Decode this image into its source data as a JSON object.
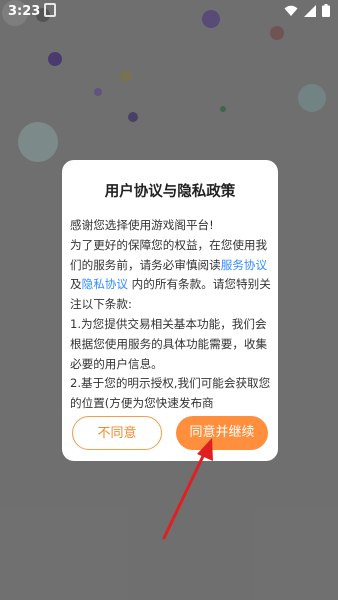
{
  "status_bar": {
    "time": "3:23"
  },
  "dialog": {
    "title": "用户协议与隐私政策",
    "line1": "感谢您选择使用游戏阁平台!",
    "line2a": "  为了更好的保障您的权益，在您使用我们的服务前，请务必审慎阅读",
    "link_service": "服务协议",
    "and": "及",
    "link_privacy": "隐私协议",
    "line2b": " 内的所有条款。请您特别关注以下条款:",
    "item1": " 1.为您提供交易相关基本功能，我们会根据您使用服务的具体功能需要，收集必要的用户信息。",
    "item2": " 2.基于您的明示授权,我们可能会获取您的位置(方便为您快速发布商",
    "btn_disagree": "不同意",
    "btn_agree": "同意并继续"
  },
  "colors": {
    "accent": "#ff8f3d",
    "link": "#2f8cff",
    "annotation_arrow": "#e02020"
  }
}
